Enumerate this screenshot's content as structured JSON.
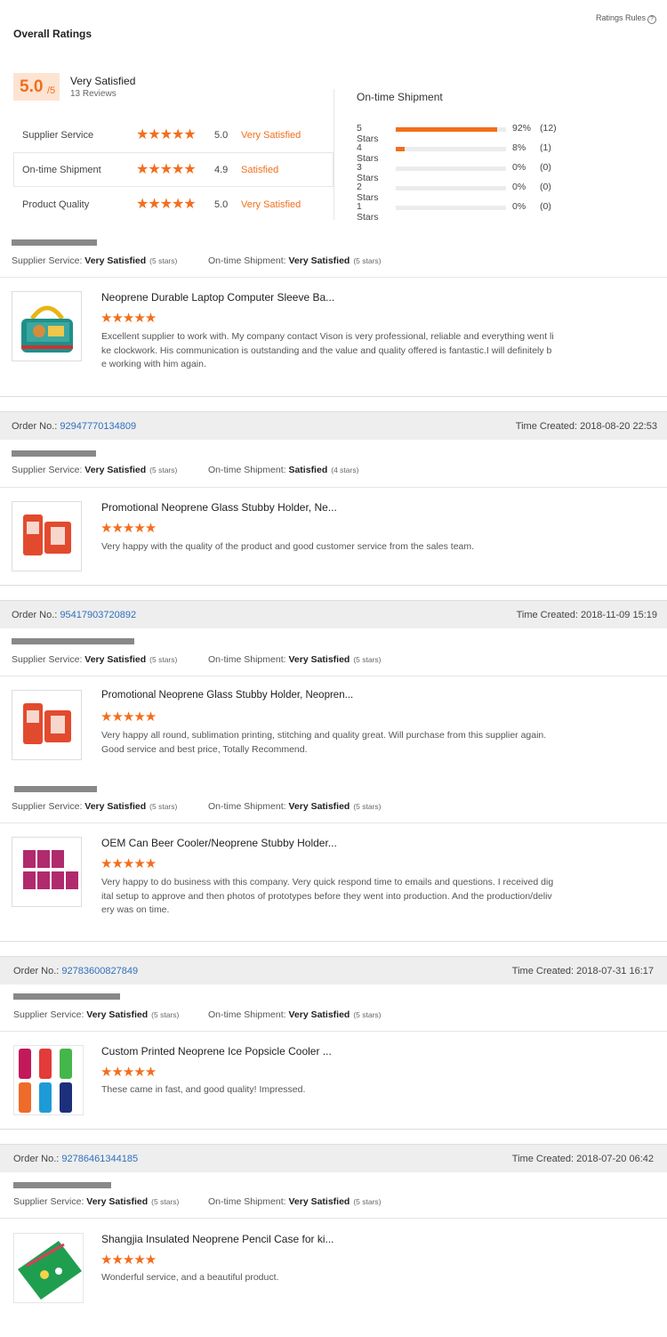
{
  "header": {
    "title": "Overall Ratings",
    "rules_label": "Ratings Rules",
    "rules_icon": "question-circle-icon"
  },
  "overall": {
    "score": "5.0",
    "denominator": "/5",
    "label": "Very Satisfied",
    "reviews": "13 Reviews"
  },
  "ratings": [
    {
      "label": "Supplier Service",
      "value": "5.0",
      "text": "Very Satisfied",
      "stars": 5
    },
    {
      "label": "On-time Shipment",
      "value": "4.9",
      "text": "Satisfied",
      "stars": 5
    },
    {
      "label": "Product Quality",
      "value": "5.0",
      "text": "Very Satisfied",
      "stars": 5
    }
  ],
  "shipment": {
    "title": "On-time Shipment",
    "rows": [
      {
        "label": "5 Stars",
        "percent": "92%",
        "count": "(12)",
        "fraction": 0.92
      },
      {
        "label": "4 Stars",
        "percent": "8%",
        "count": "(1)",
        "fraction": 0.08
      },
      {
        "label": "3 Stars",
        "percent": "0%",
        "count": "(0)",
        "fraction": 0
      },
      {
        "label": "2 Stars",
        "percent": "0%",
        "count": "(0)",
        "fraction": 0
      },
      {
        "label": "1 Stars",
        "percent": "0%",
        "count": "(0)",
        "fraction": 0
      }
    ]
  },
  "labels": {
    "supplier_service": "Supplier Service:",
    "ontime_shipment": "On-time Shipment:",
    "order_no": "Order No.:",
    "time_created": "Time Created:",
    "stars_glyph": "★★★★★"
  },
  "reviews": [
    {
      "supplier_rating": "Very Satisfied",
      "supplier_stars": "(5 stars)",
      "shipment_rating": "Very Satisfied",
      "shipment_stars": "(5 stars)",
      "product": "Neoprene Durable Laptop Computer Sleeve Ba...",
      "comment": "Excellent supplier to work with. My company contact Vison is very professional, reliable and everything went like clockwork. His communication is outstanding and the value and quality offered is fantastic.I will definitely be working with him again.",
      "stars": 5
    },
    {
      "order_no": "92947770134809",
      "time": "2018-08-20 22:53",
      "supplier_rating": "Very Satisfied",
      "supplier_stars": "(5 stars)",
      "shipment_rating": "Satisfied",
      "shipment_stars": "(4 stars)",
      "product": "Promotional Neoprene Glass Stubby Holder, Ne...",
      "comment": "Very happy with the quality of the product and good customer service from the sales team.",
      "stars": 5
    },
    {
      "order_no": "95417903720892",
      "time": "2018-11-09 15:19",
      "supplier_rating": "Very Satisfied",
      "supplier_stars": "(5 stars)",
      "shipment_rating": "Very Satisfied",
      "shipment_stars": "(5 stars)",
      "product": "Promotional Neoprene Glass Stubby Holder, Neopren...",
      "comment": "Very happy all round, sublimation printing, stitching and quality great. Will purchase from this supplier again. Good service and best price, Totally Recommend.",
      "stars": 5
    },
    {
      "supplier_rating": "Very Satisfied",
      "supplier_stars": "(5 stars)",
      "shipment_rating": "Very Satisfied",
      "shipment_stars": "(5 stars)",
      "product": "OEM Can Beer Cooler/Neoprene Stubby Holder...",
      "comment": "Very happy to do business with this company. Very quick respond time to emails and questions. I received digital setup to approve and then photos of prototypes before they went into production. And the production/delivery was on time.",
      "stars": 5
    },
    {
      "order_no": "92783600827849",
      "time": "2018-07-31 16:17",
      "supplier_rating": "Very Satisfied",
      "supplier_stars": "(5 stars)",
      "shipment_rating": "Very Satisfied",
      "shipment_stars": "(5 stars)",
      "product": "Custom Printed Neoprene Ice Popsicle Cooler ...",
      "comment": "These came in fast, and good quality! Impressed.",
      "stars": 5
    },
    {
      "order_no": "92786461344185",
      "time": "2018-07-20 06:42",
      "supplier_rating": "Very Satisfied",
      "supplier_stars": "(5 stars)",
      "shipment_rating": "Very Satisfied",
      "shipment_stars": "(5 stars)",
      "product": "Shangjia Insulated Neoprene Pencil Case for ki...",
      "comment": "Wonderful service, and a beautiful product.",
      "stars": 5
    }
  ],
  "colors": {
    "accent": "#f26e1c",
    "link": "#2f6fbd",
    "score_bg": "#fde3d2",
    "order_bar": "#eeeeee"
  }
}
